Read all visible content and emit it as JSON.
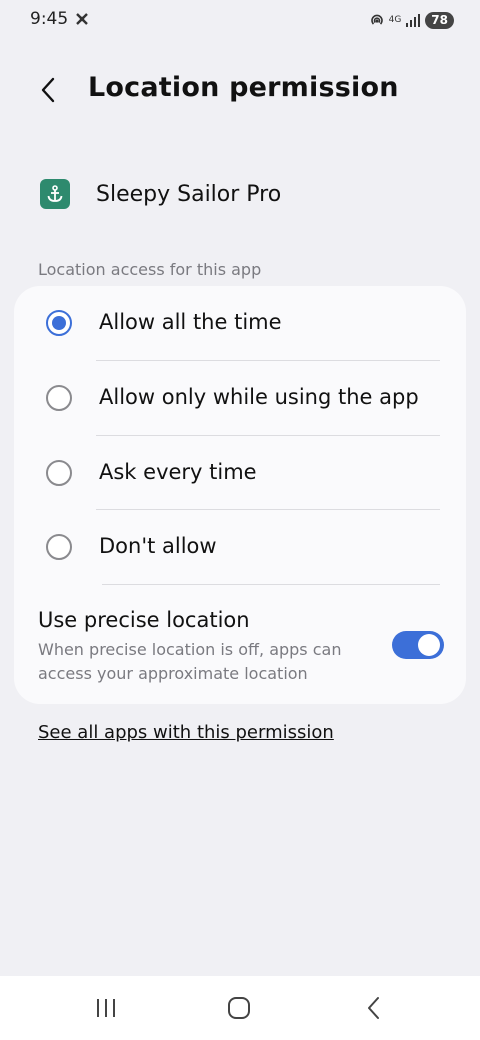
{
  "status_bar": {
    "time": "9:45",
    "network": "4G",
    "battery": "78"
  },
  "header": {
    "title": "Location permission",
    "back_icon": "chevron-left-icon"
  },
  "app": {
    "name": "Sleepy Sailor Pro",
    "icon": "anchor-icon",
    "icon_color": "#2e8a6e"
  },
  "section_label": "Location access for this app",
  "options": [
    {
      "label": "Allow all the time",
      "selected": true
    },
    {
      "label": "Allow only while using the app",
      "selected": false
    },
    {
      "label": "Ask every time",
      "selected": false
    },
    {
      "label": "Don't allow",
      "selected": false
    }
  ],
  "precise_location": {
    "title": "Use precise location",
    "description": "When precise location is off, apps can access your approximate location",
    "enabled": true
  },
  "see_all_link": "See all apps with this permission",
  "accent_color": "#3c6fd8",
  "nav_bar": {
    "recents_icon": "recents-icon",
    "home_icon": "home-icon",
    "back_icon": "back-icon"
  }
}
